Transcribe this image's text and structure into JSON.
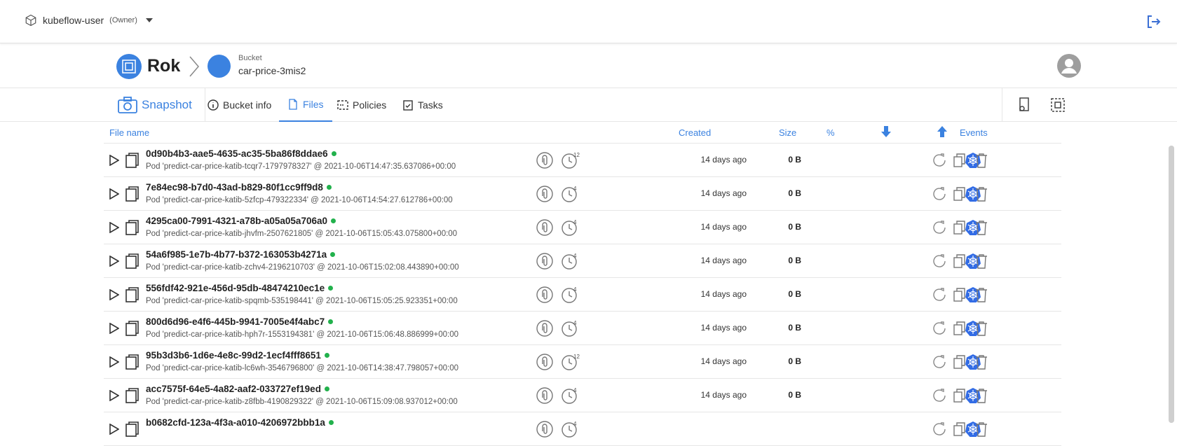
{
  "topbar": {
    "namespace": "kubeflow-user",
    "role": "(Owner)"
  },
  "header": {
    "app_title": "Rok",
    "bucket_label": "Bucket",
    "bucket_name": "car-price-3mis2",
    "bucket_color": "#3b82e0"
  },
  "tabs": {
    "snapshot": "Snapshot",
    "bucket_info": "Bucket info",
    "files": "Files",
    "policies": "Policies",
    "tasks": "Tasks"
  },
  "table": {
    "headers": {
      "file_name": "File name",
      "created": "Created",
      "size": "Size",
      "percent": "%",
      "events": "Events"
    },
    "rows": [
      {
        "name": "0d90b4b3-aae5-4635-ac35-5ba86f8ddae6",
        "desc": "Pod 'predict-car-price-katib-tcqr7-1797978327' @ 2021-10-06T14:47:35.637086+00:00",
        "versions": "12",
        "created": "14 days ago",
        "size": "0 B"
      },
      {
        "name": "7e84ec98-b7d0-43ad-b829-80f1cc9ff9d8",
        "desc": "Pod 'predict-car-price-katib-5zfcp-479322334' @ 2021-10-06T14:54:27.612786+00:00",
        "versions": "4",
        "created": "14 days ago",
        "size": "0 B"
      },
      {
        "name": "4295ca00-7991-4321-a78b-a05a05a706a0",
        "desc": "Pod 'predict-car-price-katib-jhvfm-2507621805' @ 2021-10-06T15:05:43.075800+00:00",
        "versions": "4",
        "created": "14 days ago",
        "size": "0 B"
      },
      {
        "name": "54a6f985-1e7b-4b77-b372-163053b4271a",
        "desc": "Pod 'predict-car-price-katib-zchv4-2196210703' @ 2021-10-06T15:02:08.443890+00:00",
        "versions": "4",
        "created": "14 days ago",
        "size": "0 B"
      },
      {
        "name": "556fdf42-921e-456d-95db-48474210ec1e",
        "desc": "Pod 'predict-car-price-katib-spqmb-535198441' @ 2021-10-06T15:05:25.923351+00:00",
        "versions": "4",
        "created": "14 days ago",
        "size": "0 B"
      },
      {
        "name": "800d6d96-e4f6-445b-9941-7005e4f4abc7",
        "desc": "Pod 'predict-car-price-katib-hph7r-1553194381' @ 2021-10-06T15:06:48.886999+00:00",
        "versions": "4",
        "created": "14 days ago",
        "size": "0 B"
      },
      {
        "name": "95b3d3b6-1d6e-4e8c-99d2-1ecf4fff8651",
        "desc": "Pod 'predict-car-price-katib-lc6wh-3546796800' @ 2021-10-06T14:38:47.798057+00:00",
        "versions": "12",
        "created": "14 days ago",
        "size": "0 B"
      },
      {
        "name": "acc7575f-64e5-4a82-aaf2-033727ef19ed",
        "desc": "Pod 'predict-car-price-katib-z8fbb-4190829322' @ 2021-10-06T15:09:08.937012+00:00",
        "versions": "4",
        "created": "14 days ago",
        "size": "0 B"
      },
      {
        "name": "b0682cfd-123a-4f3a-a010-4206972bbb1a",
        "desc": "",
        "versions": "4",
        "created": "",
        "size": ""
      }
    ]
  },
  "colors": {
    "accent": "#3b82e0",
    "status_ok": "#22b14c",
    "k8s": "#326ce5"
  }
}
